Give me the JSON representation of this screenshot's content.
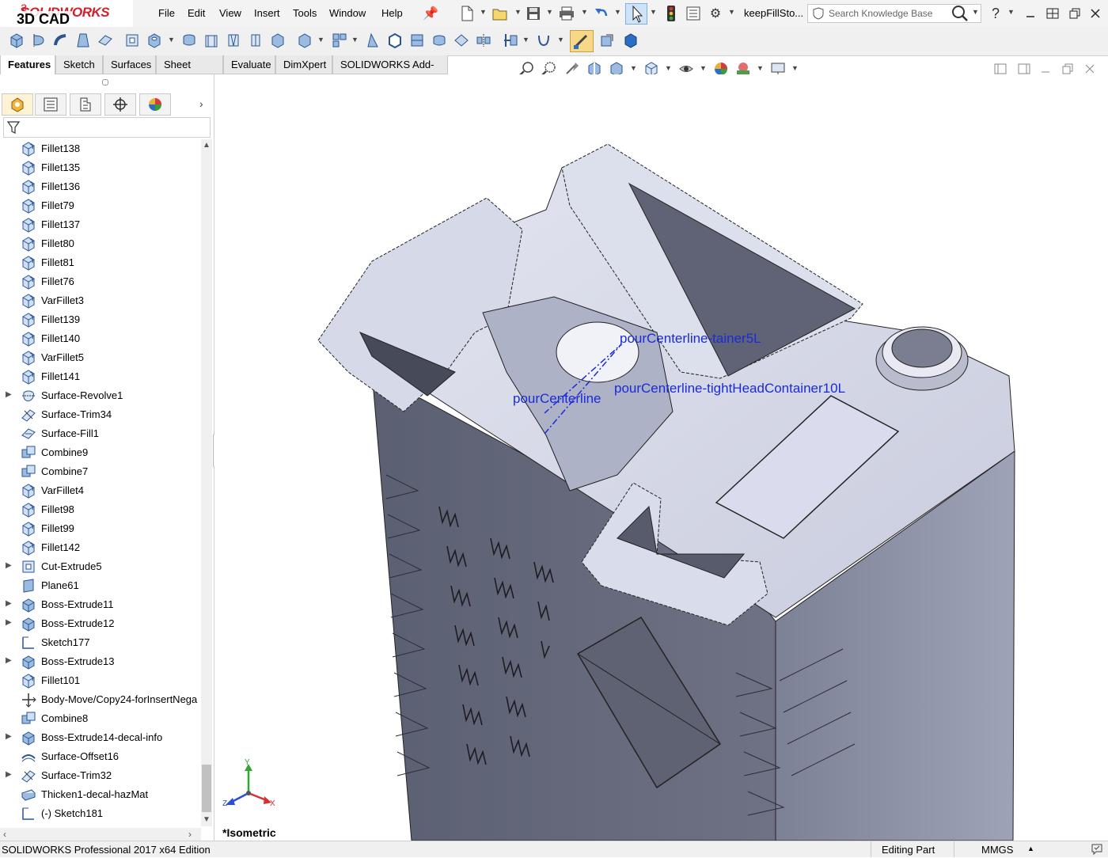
{
  "app": {
    "logo_text": "SOLIDWORKS",
    "logo_overlay": "3D CAD",
    "brand_color": "#d0202a"
  },
  "menu": {
    "items": [
      "File",
      "Edit",
      "View",
      "Insert",
      "Tools",
      "Window",
      "Help"
    ]
  },
  "document": {
    "name": "keepFillSto..."
  },
  "search": {
    "placeholder": "Search Knowledge Base"
  },
  "command_tabs": [
    {
      "label": "Features",
      "active": true
    },
    {
      "label": "Sketch"
    },
    {
      "label": "Surfaces"
    },
    {
      "label": "Sheet Metal"
    },
    {
      "label": "Evaluate"
    },
    {
      "label": "DimXpert"
    },
    {
      "label": "SOLIDWORKS Add-Ins"
    }
  ],
  "feature_tree": {
    "items": [
      {
        "label": "Fillet138",
        "icon": "fillet-icon"
      },
      {
        "label": "Fillet135",
        "icon": "fillet-icon"
      },
      {
        "label": "Fillet136",
        "icon": "fillet-icon"
      },
      {
        "label": "Fillet79",
        "icon": "fillet-icon"
      },
      {
        "label": "Fillet137",
        "icon": "fillet-icon"
      },
      {
        "label": "Fillet80",
        "icon": "fillet-icon"
      },
      {
        "label": "Fillet81",
        "icon": "fillet-icon"
      },
      {
        "label": "Fillet76",
        "icon": "fillet-icon"
      },
      {
        "label": "VarFillet3",
        "icon": "fillet-icon"
      },
      {
        "label": "Fillet139",
        "icon": "fillet-icon"
      },
      {
        "label": "Fillet140",
        "icon": "fillet-icon"
      },
      {
        "label": "VarFillet5",
        "icon": "fillet-icon"
      },
      {
        "label": "Fillet141",
        "icon": "fillet-icon"
      },
      {
        "label": "Surface-Revolve1",
        "icon": "surface-revolve-icon",
        "expandable": true
      },
      {
        "label": "Surface-Trim34",
        "icon": "surface-trim-icon"
      },
      {
        "label": "Surface-Fill1",
        "icon": "surface-fill-icon"
      },
      {
        "label": "Combine9",
        "icon": "combine-icon"
      },
      {
        "label": "Combine7",
        "icon": "combine-icon"
      },
      {
        "label": "VarFillet4",
        "icon": "fillet-icon"
      },
      {
        "label": "Fillet98",
        "icon": "fillet-icon"
      },
      {
        "label": "Fillet99",
        "icon": "fillet-icon"
      },
      {
        "label": "Fillet142",
        "icon": "fillet-icon"
      },
      {
        "label": "Cut-Extrude5",
        "icon": "cut-extrude-icon",
        "expandable": true
      },
      {
        "label": "Plane61",
        "icon": "plane-icon"
      },
      {
        "label": "Boss-Extrude11",
        "icon": "boss-extrude-icon",
        "expandable": true
      },
      {
        "label": "Boss-Extrude12",
        "icon": "boss-extrude-icon",
        "expandable": true
      },
      {
        "label": "Sketch177",
        "icon": "sketch-icon"
      },
      {
        "label": "Boss-Extrude13",
        "icon": "boss-extrude-icon",
        "expandable": true
      },
      {
        "label": "Fillet101",
        "icon": "fillet-icon"
      },
      {
        "label": "Body-Move/Copy24-forInsertNega",
        "icon": "move-copy-icon"
      },
      {
        "label": "Combine8",
        "icon": "combine-icon"
      },
      {
        "label": "Boss-Extrude14-decal-info",
        "icon": "boss-extrude-icon",
        "expandable": true
      },
      {
        "label": "Surface-Offset16",
        "icon": "surface-offset-icon"
      },
      {
        "label": "Surface-Trim32",
        "icon": "surface-trim-icon",
        "expandable": true
      },
      {
        "label": "Thicken1-decal-hazMat",
        "icon": "thicken-icon"
      },
      {
        "label": "(-) Sketch181",
        "icon": "sketch-icon"
      }
    ]
  },
  "viewport": {
    "view_name": "*Isometric",
    "annotations": [
      "pourCenterline-tainer5L",
      "pourCenterline",
      "pourCenterline-tightHeadContainer10L"
    ],
    "triad": {
      "x": "X",
      "y": "Y",
      "z": "Z"
    }
  },
  "status": {
    "product": "SOLIDWORKS Professional 2017 x64 Edition",
    "mode": "Editing Part",
    "units": "MMGS"
  }
}
